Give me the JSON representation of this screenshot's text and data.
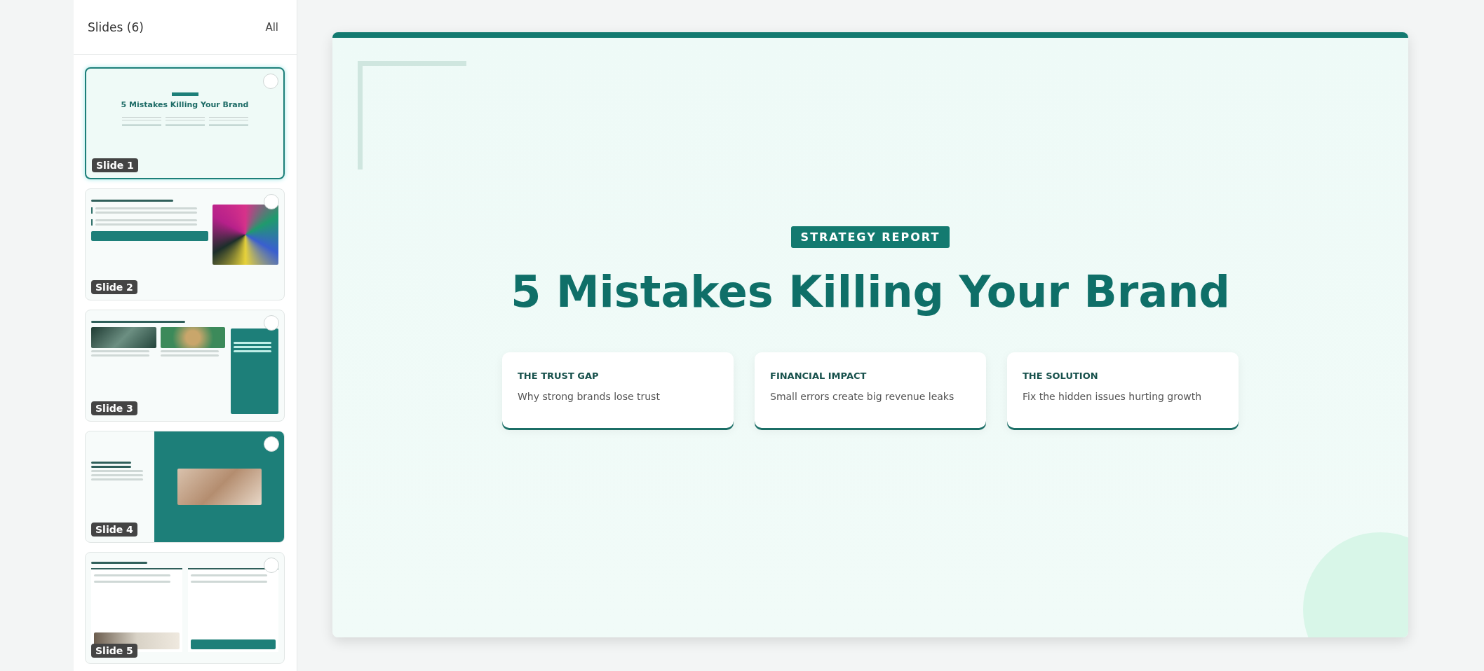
{
  "sidebar": {
    "title": "Slides (6)",
    "filter": "All",
    "slides": [
      {
        "label": "Slide 1",
        "selected": true,
        "kind": "title",
        "title": "5 Mistakes Killing Your Brand"
      },
      {
        "label": "Slide 2",
        "selected": false,
        "kind": "text-photo"
      },
      {
        "label": "Slide 3",
        "selected": false,
        "kind": "three-col"
      },
      {
        "label": "Slide 4",
        "selected": false,
        "kind": "image-panel"
      },
      {
        "label": "Slide 5",
        "selected": false,
        "kind": "two-cards"
      }
    ]
  },
  "slide": {
    "badge": "STRATEGY REPORT",
    "title": "5 Mistakes Killing Your Brand",
    "cards": [
      {
        "heading": "THE TRUST GAP",
        "text": "Why strong brands lose trust"
      },
      {
        "heading": "FINANCIAL IMPACT",
        "text": "Small errors create big revenue leaks"
      },
      {
        "heading": "THE SOLUTION",
        "text": "Fix the hidden issues hurting growth"
      }
    ]
  }
}
